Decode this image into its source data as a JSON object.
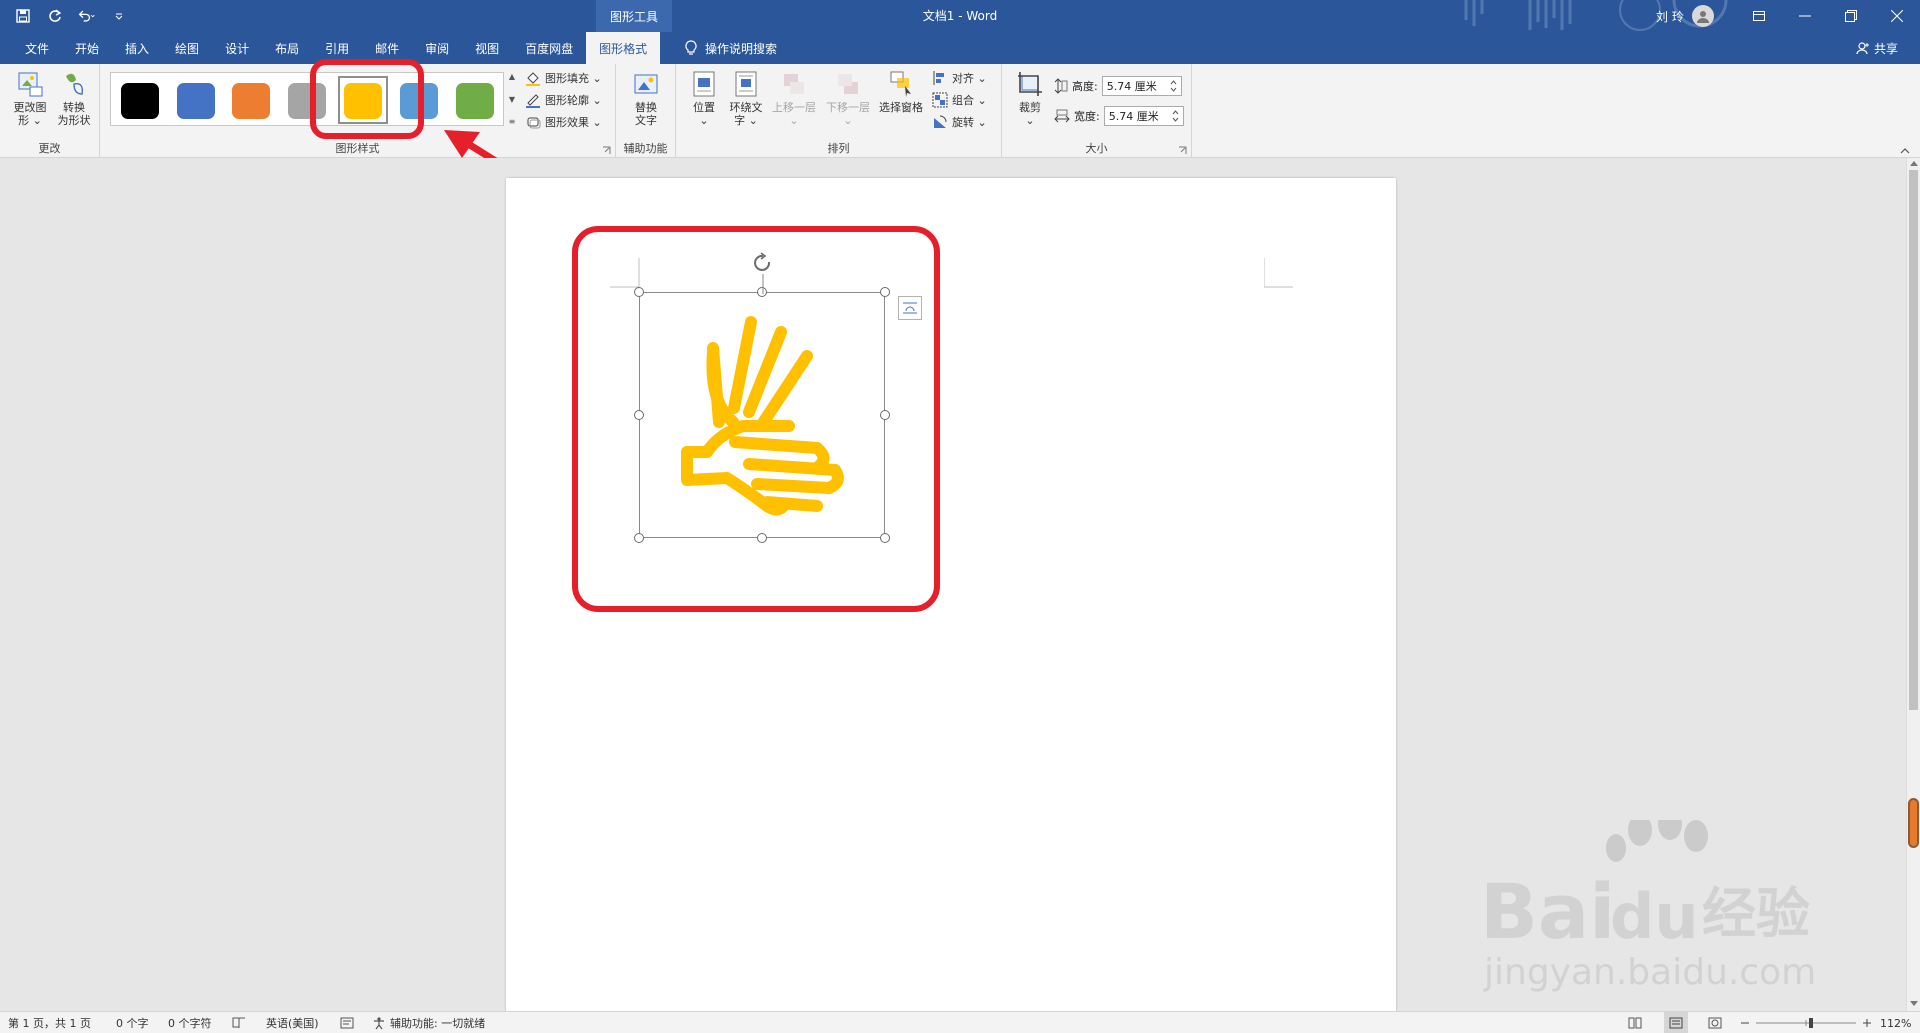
{
  "window": {
    "doc_title": "文档1  -  Word",
    "context_tab_label": "图形工具",
    "user_name": "刘 玲"
  },
  "tabs": [
    {
      "label": "文件"
    },
    {
      "label": "开始"
    },
    {
      "label": "插入"
    },
    {
      "label": "绘图"
    },
    {
      "label": "设计"
    },
    {
      "label": "布局"
    },
    {
      "label": "引用"
    },
    {
      "label": "邮件"
    },
    {
      "label": "审阅"
    },
    {
      "label": "视图"
    },
    {
      "label": "百度网盘"
    },
    {
      "label": "图形格式",
      "active": true
    }
  ],
  "tell_me": "操作说明搜索",
  "share": "共享",
  "ribbon": {
    "change_group": {
      "label": "更改",
      "change_graphic_l1": "更改图",
      "change_graphic_l2": "形 ⌄",
      "convert_l1": "转换",
      "convert_l2": "为形状"
    },
    "styles_group": {
      "label": "图形样式",
      "swatches": [
        "#000000",
        "#4472c4",
        "#ed7d31",
        "#a5a5a5",
        "#ffc000",
        "#5b9bd5",
        "#70ad47"
      ],
      "selected_index": 4,
      "fill": "图形填充 ⌄",
      "outline": "图形轮廓 ⌄",
      "effects": "图形效果 ⌄"
    },
    "accessibility_group": {
      "label": "辅助功能",
      "alt_text_l1": "替换",
      "alt_text_l2": "文字"
    },
    "arrange_group": {
      "label": "排列",
      "position_l1": "位置",
      "position_l2": "⌄",
      "wrap_l1": "环绕文",
      "wrap_l2": "字 ⌄",
      "forward_l1": "上移一层",
      "forward_l2": "⌄",
      "backward_l1": "下移一层",
      "backward_l2": "⌄",
      "selection_pane": "选择窗格",
      "align": "对齐 ⌄",
      "group": "组合 ⌄",
      "rotate": "旋转 ⌄"
    },
    "size_group": {
      "label": "大小",
      "crop_l1": "裁剪",
      "crop_l2": "⌄",
      "height_label": "高度:",
      "height_value": "5.74 厘米",
      "width_label": "宽度:",
      "width_value": "5.74 厘米"
    }
  },
  "status": {
    "page": "第 1 页，共 1 页",
    "words": "0 个字",
    "chars": "0 个字符",
    "language": "英语(美国)",
    "accessibility": "辅助功能: 一切就绪",
    "zoom": "112%"
  },
  "colors": {
    "accent": "#2b579a",
    "icon_fill": "#ffc000",
    "highlight": "#e5202b"
  },
  "watermark": {
    "brand": "Bai",
    "brand2": "du",
    "cn": "经验",
    "url": "jingyan.baidu.com"
  }
}
